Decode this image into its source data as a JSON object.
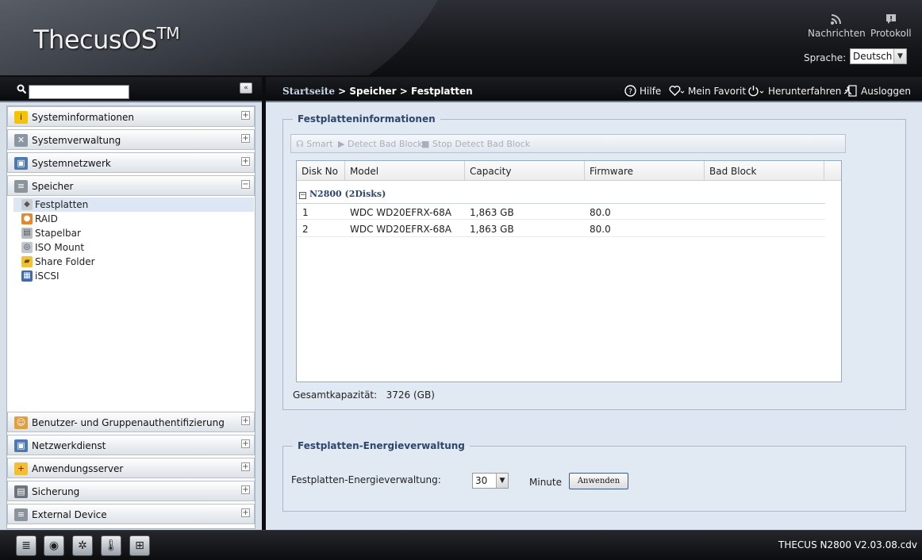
{
  "header": {
    "logo": "ThecusOS",
    "logo_tm": "TM",
    "messages": "Nachrichten",
    "log": "Protokoll",
    "language_label": "Sprache:",
    "language_value": "Deutsch"
  },
  "sidebar": {
    "categories": [
      {
        "label": "Systeminformationen",
        "toggle": "+",
        "icon": "info-icon"
      },
      {
        "label": "Systemverwaltung",
        "toggle": "+",
        "icon": "tools-icon"
      },
      {
        "label": "Systemnetzwerk",
        "toggle": "+",
        "icon": "network-icon"
      },
      {
        "label": "Speicher",
        "toggle": "−",
        "icon": "storage-icon"
      },
      {
        "label": "Benutzer- und Gruppenauthentifizierung",
        "toggle": "+",
        "icon": "users-icon"
      },
      {
        "label": "Netzwerkdienst",
        "toggle": "+",
        "icon": "network-service-icon"
      },
      {
        "label": "Anwendungsserver",
        "toggle": "+",
        "icon": "app-server-icon"
      },
      {
        "label": "Sicherung",
        "toggle": "+",
        "icon": "backup-icon"
      },
      {
        "label": "External Device",
        "toggle": "+",
        "icon": "external-device-icon"
      }
    ],
    "storage_items": [
      {
        "label": "Festplatten",
        "icon": "disk-icon"
      },
      {
        "label": "RAID",
        "icon": "raid-icon"
      },
      {
        "label": "Stapelbar",
        "icon": "stackable-icon"
      },
      {
        "label": "ISO Mount",
        "icon": "iso-icon"
      },
      {
        "label": "Share Folder",
        "icon": "folder-icon"
      },
      {
        "label": "iSCSI",
        "icon": "iscsi-icon"
      }
    ]
  },
  "topbar": {
    "home": "Startseite",
    "path": " > Speicher > Festplatten",
    "help": "Hilfe",
    "favorite": "Mein Favorit",
    "shutdown": "Herunterfahren",
    "logout": "Ausloggen"
  },
  "disk_info": {
    "legend": "Festplatteninformationen",
    "tools": [
      "Smart",
      "Detect Bad Block",
      "Stop Detect Bad Block"
    ],
    "columns": [
      "Disk No",
      "Model",
      "Capacity",
      "Firmware",
      "Bad Block"
    ],
    "group": "N2800 (2Disks)",
    "rows": [
      {
        "no": "1",
        "model": "WDC WD20EFRX-68A",
        "capacity": "1,863 GB",
        "firmware": "80.0",
        "bad_block": ""
      },
      {
        "no": "2",
        "model": "WDC WD20EFRX-68A",
        "capacity": "1,863 GB",
        "firmware": "80.0",
        "bad_block": ""
      }
    ],
    "total_label": "Gesamtkapazität:",
    "total_value": "3726 (GB)"
  },
  "power": {
    "legend": "Festplatten-Energieverwaltung",
    "label": "Festplatten-Energieverwaltung:",
    "value": "30",
    "unit": "Minute",
    "apply": "Anwenden"
  },
  "footer": {
    "version": "THECUS N2800 V2.03.08.cdv",
    "icons": [
      "server-status-icon",
      "disk-status-icon",
      "fan-icon",
      "temperature-icon",
      "network-status-icon"
    ]
  }
}
